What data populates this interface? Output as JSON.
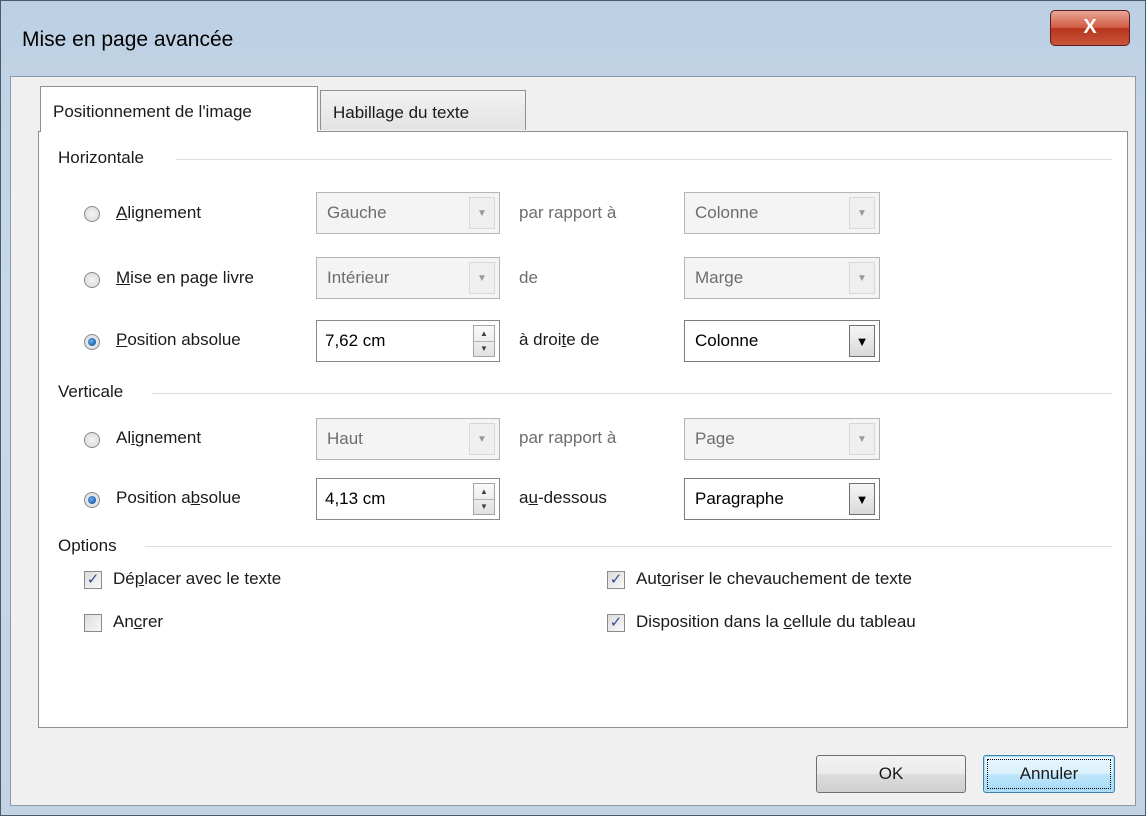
{
  "window": {
    "title": "Mise en page avancée",
    "close_label": "X"
  },
  "tabs": [
    {
      "label": "Positionnement de l'image",
      "active": true
    },
    {
      "label": "Habillage du texte",
      "active": false
    }
  ],
  "horizontal": {
    "heading": "Horizontale",
    "alignment": {
      "label_pre": "",
      "label_u": "A",
      "label_post": "lignement",
      "combo": "Gauche",
      "relation": "par rapport à",
      "target": "Colonne",
      "selected": false,
      "enabled": false
    },
    "book": {
      "label_u": "M",
      "label_post": "ise en page livre",
      "combo": "Intérieur",
      "relation": "de",
      "target": "Marge",
      "selected": false,
      "enabled": false
    },
    "absolute": {
      "label_u": "P",
      "label_post": "osition absolue",
      "value": "7,62 cm",
      "relation_pre": "à droi",
      "relation_u": "t",
      "relation_post": "e de",
      "target": "Colonne",
      "selected": true
    }
  },
  "vertical": {
    "heading": "Verticale",
    "alignment": {
      "label_pre": "Al",
      "label_u": "i",
      "label_post": "gnement",
      "combo": "Haut",
      "relation": "par rapport à",
      "target": "Page",
      "selected": false,
      "enabled": false
    },
    "absolute": {
      "label_pre": "Position a",
      "label_u": "b",
      "label_post": "solue",
      "value": "4,13 cm",
      "relation_pre": "a",
      "relation_u": "u",
      "relation_post": "-dessous",
      "target": "Paragraphe",
      "selected": true
    }
  },
  "options": {
    "heading": "Options",
    "move_with_text": {
      "pre": "Dé",
      "u": "p",
      "post": "lacer avec le texte",
      "checked": true
    },
    "anchor": {
      "pre": "An",
      "u": "c",
      "post": "rer",
      "checked": false
    },
    "allow_overlap": {
      "pre": "Aut",
      "u": "o",
      "post": "riser le chevauchement de texte",
      "checked": true
    },
    "layout_in_cell": {
      "pre": "Disposition dans la ",
      "u": "c",
      "post": "ellule du tableau",
      "checked": true
    }
  },
  "buttons": {
    "ok": "OK",
    "cancel": "Annuler"
  },
  "colors": {
    "accent": "#1c5fb0",
    "title_bar": "#c9d9ea",
    "close": "#c9553b"
  }
}
